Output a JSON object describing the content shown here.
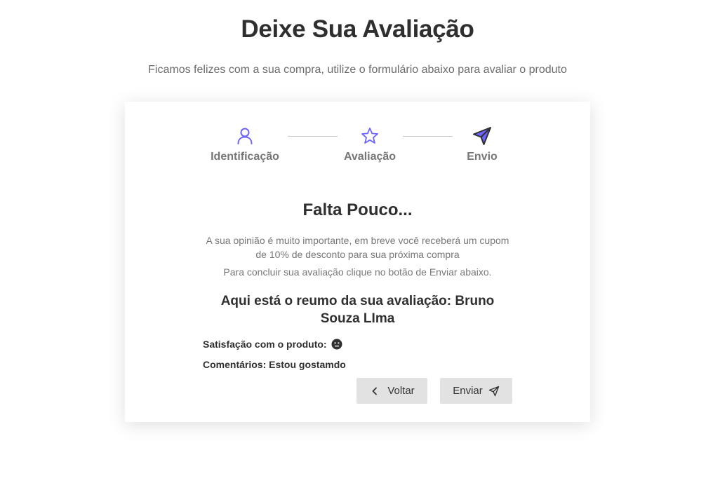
{
  "header": {
    "title": "Deixe Sua Avaliação",
    "subtitle": "Ficamos felizes com a sua compra, utilize o formulário abaixo para avaliar o produto"
  },
  "steps": [
    {
      "label": "Identificação",
      "icon": "user-icon"
    },
    {
      "label": "Avaliação",
      "icon": "star-icon"
    },
    {
      "label": "Envio",
      "icon": "send-icon"
    }
  ],
  "content": {
    "heading": "Falta Pouco...",
    "info": "A sua opinião é muito importante, em breve você receberá um cupom de 10% de desconto para sua próxima compra",
    "info_2": "Para concluir sua avaliação clique no botão de Enviar abaixo.",
    "summary_title": "Aqui está o reumo da sua avaliação: Bruno Souza LIma",
    "satisfaction_label": "Satisfação com o produto:",
    "satisfaction_icon": "neutral-face-icon",
    "comments": "Comentários: Estou gostamdo"
  },
  "buttons": {
    "back_label": "Voltar",
    "send_label": "Enviar"
  },
  "colors": {
    "accent": "#6c63ff",
    "button_bg": "#e2e2e2"
  }
}
